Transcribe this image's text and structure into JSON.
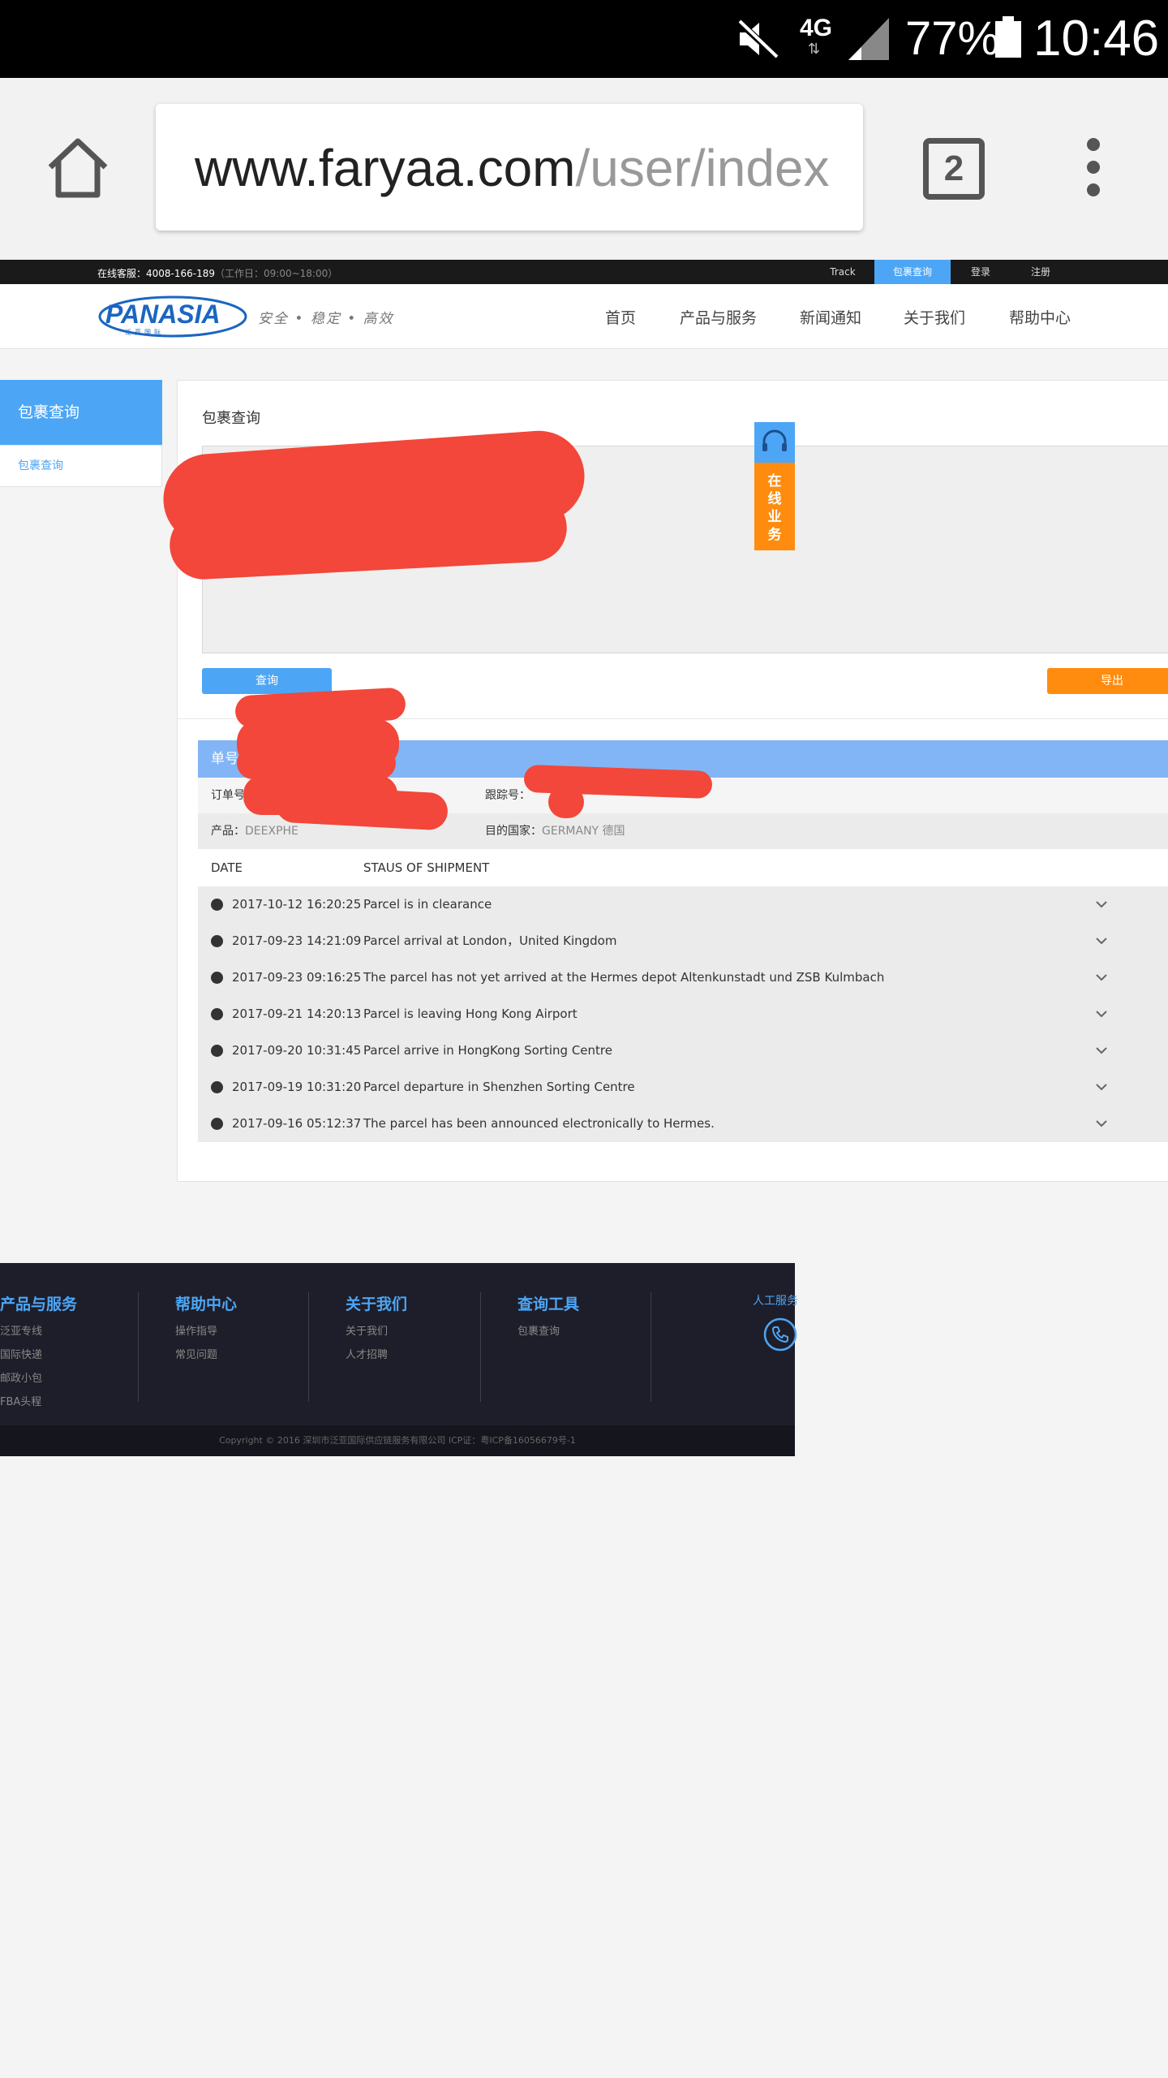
{
  "status_bar": {
    "network": "4G",
    "battery": "77%",
    "time": "10:46",
    "icons": [
      "mute-icon",
      "signal-icon",
      "battery-icon"
    ]
  },
  "browser": {
    "url_host": "www.faryaa.com",
    "url_path": "/user/index",
    "tab_count": "2"
  },
  "topbar": {
    "hotline": "在线客服：4008-166-189",
    "hours": "（工作日：09:00~18:00）",
    "links": [
      "Track",
      "包裹查询",
      "登录",
      "注册"
    ]
  },
  "nav": {
    "logo": "PANASIA",
    "logo_sub": "泛亚国际",
    "slogan": "安全 • 稳定 • 高效",
    "items": [
      "首页",
      "产品与服务",
      "新闻通知",
      "关于我们",
      "帮助中心"
    ]
  },
  "sidebar": {
    "title": "包裹查询",
    "items": [
      "包裹查询"
    ]
  },
  "panel": {
    "title": "包裹查询",
    "search_button": "查询",
    "export_button": "导出"
  },
  "float_service": {
    "label": "在线业务"
  },
  "result": {
    "head": "单号",
    "order_label": "订单号：",
    "tracking_label": "跟踪号：",
    "product_label": "产品：",
    "product_value": "DEEXPHE",
    "country_label": "目的国家：",
    "country_value": "GERMANY  德国",
    "columns": [
      "DATE",
      "STAUS OF SHIPMENT"
    ],
    "rows": [
      {
        "date": "2017-10-12 16:20:25",
        "status": "Parcel is in clearance"
      },
      {
        "date": "2017-09-23 14:21:09",
        "status": "Parcel arrival at London，United Kingdom"
      },
      {
        "date": "2017-09-23 09:16:25",
        "status": "The parcel has not yet arrived at the Hermes depot Altenkunstadt und ZSB Kulmbach"
      },
      {
        "date": "2017-09-21 14:20:13",
        "status": "Parcel is leaving Hong Kong Airport"
      },
      {
        "date": "2017-09-20 10:31:45",
        "status": "Parcel arrive in HongKong Sorting Centre"
      },
      {
        "date": "2017-09-19 10:31:20",
        "status": "Parcel departure in Shenzhen Sorting Centre"
      },
      {
        "date": "2017-09-16 05:12:37",
        "status": "The parcel has been announced electronically to Hermes."
      }
    ]
  },
  "footer": {
    "columns": [
      {
        "title": "产品与服务",
        "links": [
          "泛亚专线",
          "国际快递",
          "邮政小包",
          "FBA头程"
        ]
      },
      {
        "title": "帮助中心",
        "links": [
          "操作指导",
          "常见问题"
        ]
      },
      {
        "title": "关于我们",
        "links": [
          "关于我们",
          "人才招聘"
        ]
      },
      {
        "title": "查询工具",
        "links": [
          "包裹查询"
        ]
      }
    ],
    "service": "人工服务",
    "copyright": "Copyright © 2016  深圳市泛亚国际供应链服务有限公司    ICP证：粤ICP备16056679号-1"
  },
  "colors": {
    "accent": "#4da6f5",
    "orange": "#ff8c0f",
    "result_head": "#82b5f5",
    "redaction": "#f2473a",
    "footer_bg": "#1e1e2a"
  }
}
